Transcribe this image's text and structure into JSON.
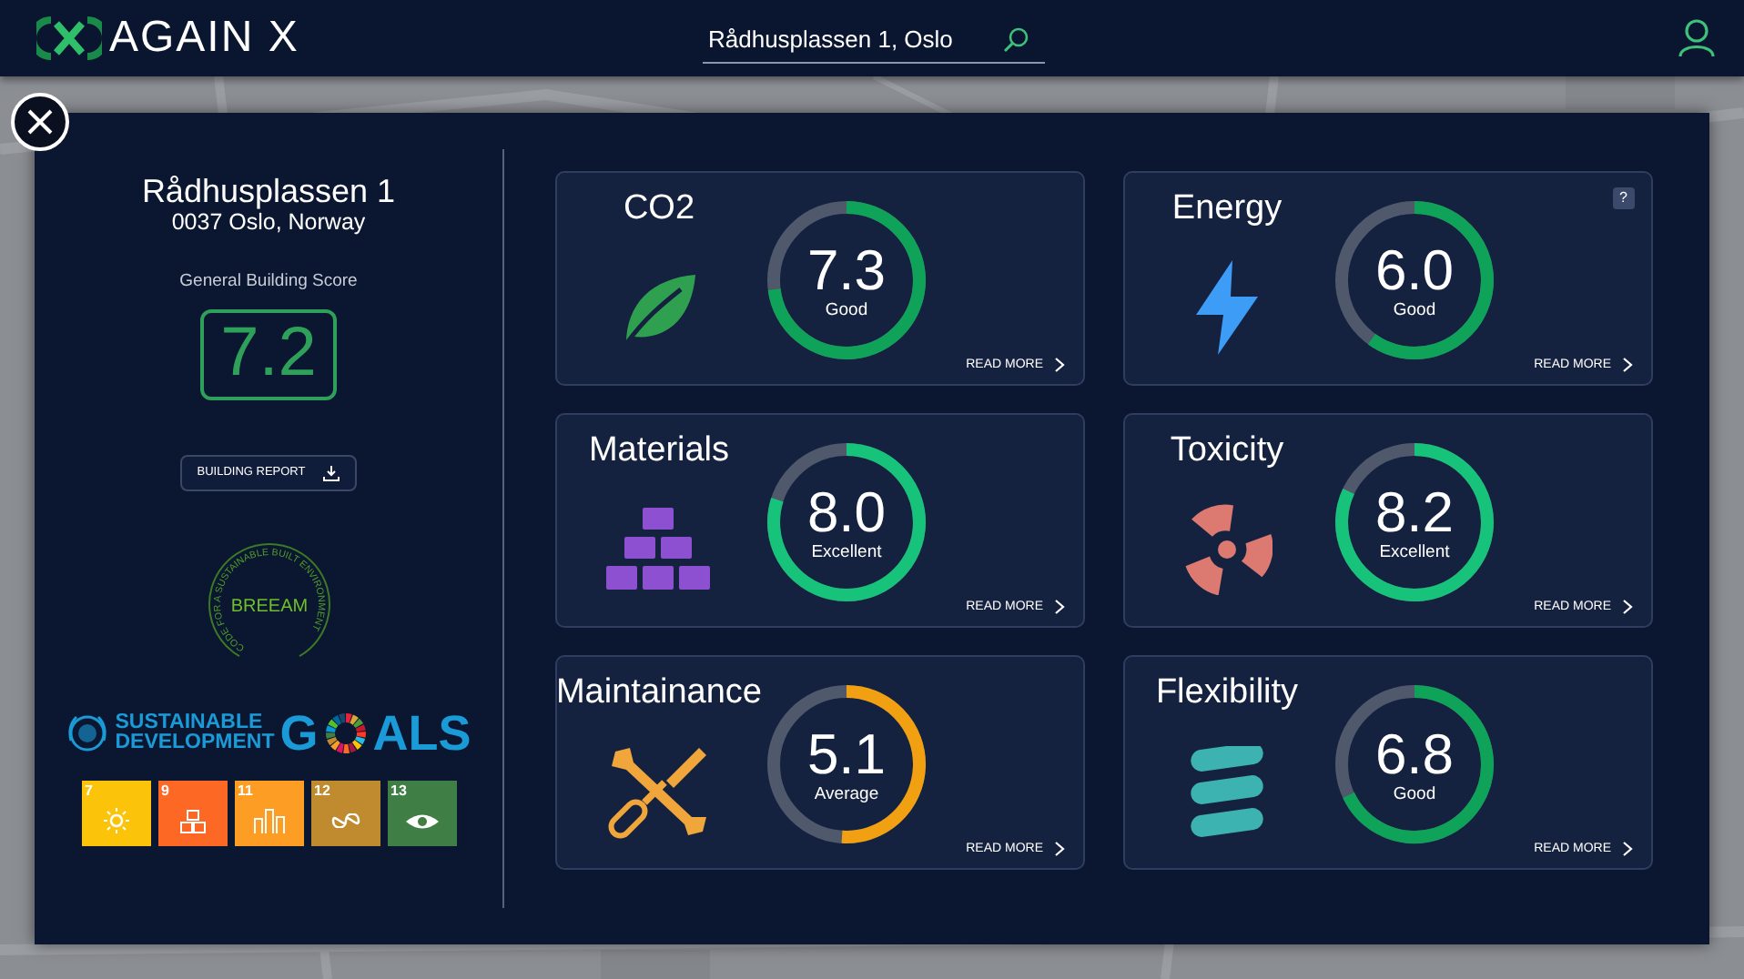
{
  "header": {
    "logo_text": "AGAIN X",
    "search": {
      "value": "Rådhusplassen 1, Oslo"
    }
  },
  "building": {
    "name": "Rådhusplassen 1",
    "address": "0037 Oslo, Norway",
    "score_label": "General Building Score",
    "score": "7.2",
    "report_button": "BUILDING REPORT"
  },
  "breeam": {
    "ring_text": "CODE FOR A SUSTAINABLE BUILT ENVIRONMENT",
    "name": "BREEAM"
  },
  "sdg_logo": {
    "line_1": "SUSTAINABLE",
    "line_2": "DEVELOPMENT",
    "word_start": "G",
    "word_end": "ALS"
  },
  "sdg_goals": [
    {
      "number": "7",
      "color": "#fcc30b"
    },
    {
      "number": "9",
      "color": "#fd6925"
    },
    {
      "number": "11",
      "color": "#fd9d24"
    },
    {
      "number": "12",
      "color": "#bf8b2e"
    },
    {
      "number": "13",
      "color": "#3f7e44"
    }
  ],
  "categories": [
    {
      "title": "CO2",
      "score": "7.3",
      "rating": "Good",
      "color": "#0fa35a",
      "link": "READ MORE"
    },
    {
      "title": "Energy",
      "score": "6.0",
      "rating": "Good",
      "color": "#0fa35a",
      "link": "READ MORE",
      "help": "?"
    },
    {
      "title": "Materials",
      "score": "8.0",
      "rating": "Excellent",
      "color": "#17c27a",
      "link": "READ MORE"
    },
    {
      "title": "Toxicity",
      "score": "8.2",
      "rating": "Excellent",
      "color": "#17c27a",
      "link": "READ MORE"
    },
    {
      "title": "Maintainance",
      "score": "5.1",
      "rating": "Average",
      "color": "#f0a010",
      "link": "READ MORE"
    },
    {
      "title": "Flexibility",
      "score": "6.8",
      "rating": "Good",
      "color": "#0fa35a",
      "link": "READ MORE"
    }
  ]
}
